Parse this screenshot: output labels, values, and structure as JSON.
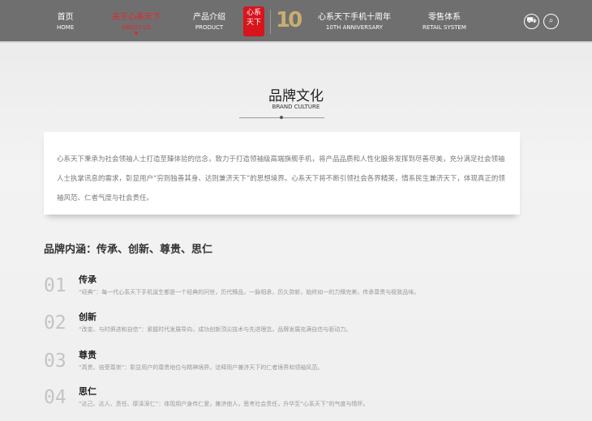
{
  "nav": {
    "items": [
      {
        "cn": "首页",
        "en": "HOME"
      },
      {
        "cn": "关于心系天下",
        "en": "ABOUT US"
      },
      {
        "cn": "产品介绍",
        "en": "PRODUCT"
      },
      {
        "cn": "心系天下手机十周年",
        "en": "10TH ANNIVERSARY"
      },
      {
        "cn": "零售体系",
        "en": "RETAIL SYSTEM"
      }
    ],
    "logo_text": "心系天下",
    "anniversary_mark": "10"
  },
  "section": {
    "title": "品牌文化",
    "subtitle": "BRAND CULTURE"
  },
  "intro": "心系天下秉承为社会领袖人士打造至臻体验的信念，致力于打造领袖级高端旗舰手机，将产品品质和人性化服务发挥到尽善尽美，充分满足社会领袖人士执掌讯息的需求，彰显用户“穷则独善其身、达则兼济天下”的思想境界。心系天下将不断引领社会各界精英，情系民生兼济天下，体现真正的领袖风范、仁者气度与社会责任。",
  "connotation": {
    "heading": "品牌内涵：传承、创新、尊贵、思仁",
    "items": [
      {
        "num": "01",
        "title": "传承",
        "desc": "“经典”：每一代心系天下手机诞生都是一个经典的问世，历代臻品，一脉相承，历久弥新，始终如一的力臻完美，传承尊贵与极致品味。"
      },
      {
        "num": "02",
        "title": "创新",
        "desc": "“改变、与时俱进和自信”：紧握时代发展导向，成功创新顶尖技术与先进理念，品牌发展充满自信与驱动力。"
      },
      {
        "num": "03",
        "title": "尊贵",
        "desc": "“高贵、倍受尊崇”：彰显用户的尊贵地位与精神境界，诠释用户兼济天下的仁者境界和领袖风范。"
      },
      {
        "num": "04",
        "title": "思仁",
        "desc": "“达己、达人、责任、厚泽深仁”：体现用户身传仁爱，兼济他人，思考社会责任，升华至“心系天下”的气度与情怀。"
      }
    ]
  },
  "colors": {
    "nav_bg": "#6f6f6f",
    "accent": "#e8242b"
  }
}
